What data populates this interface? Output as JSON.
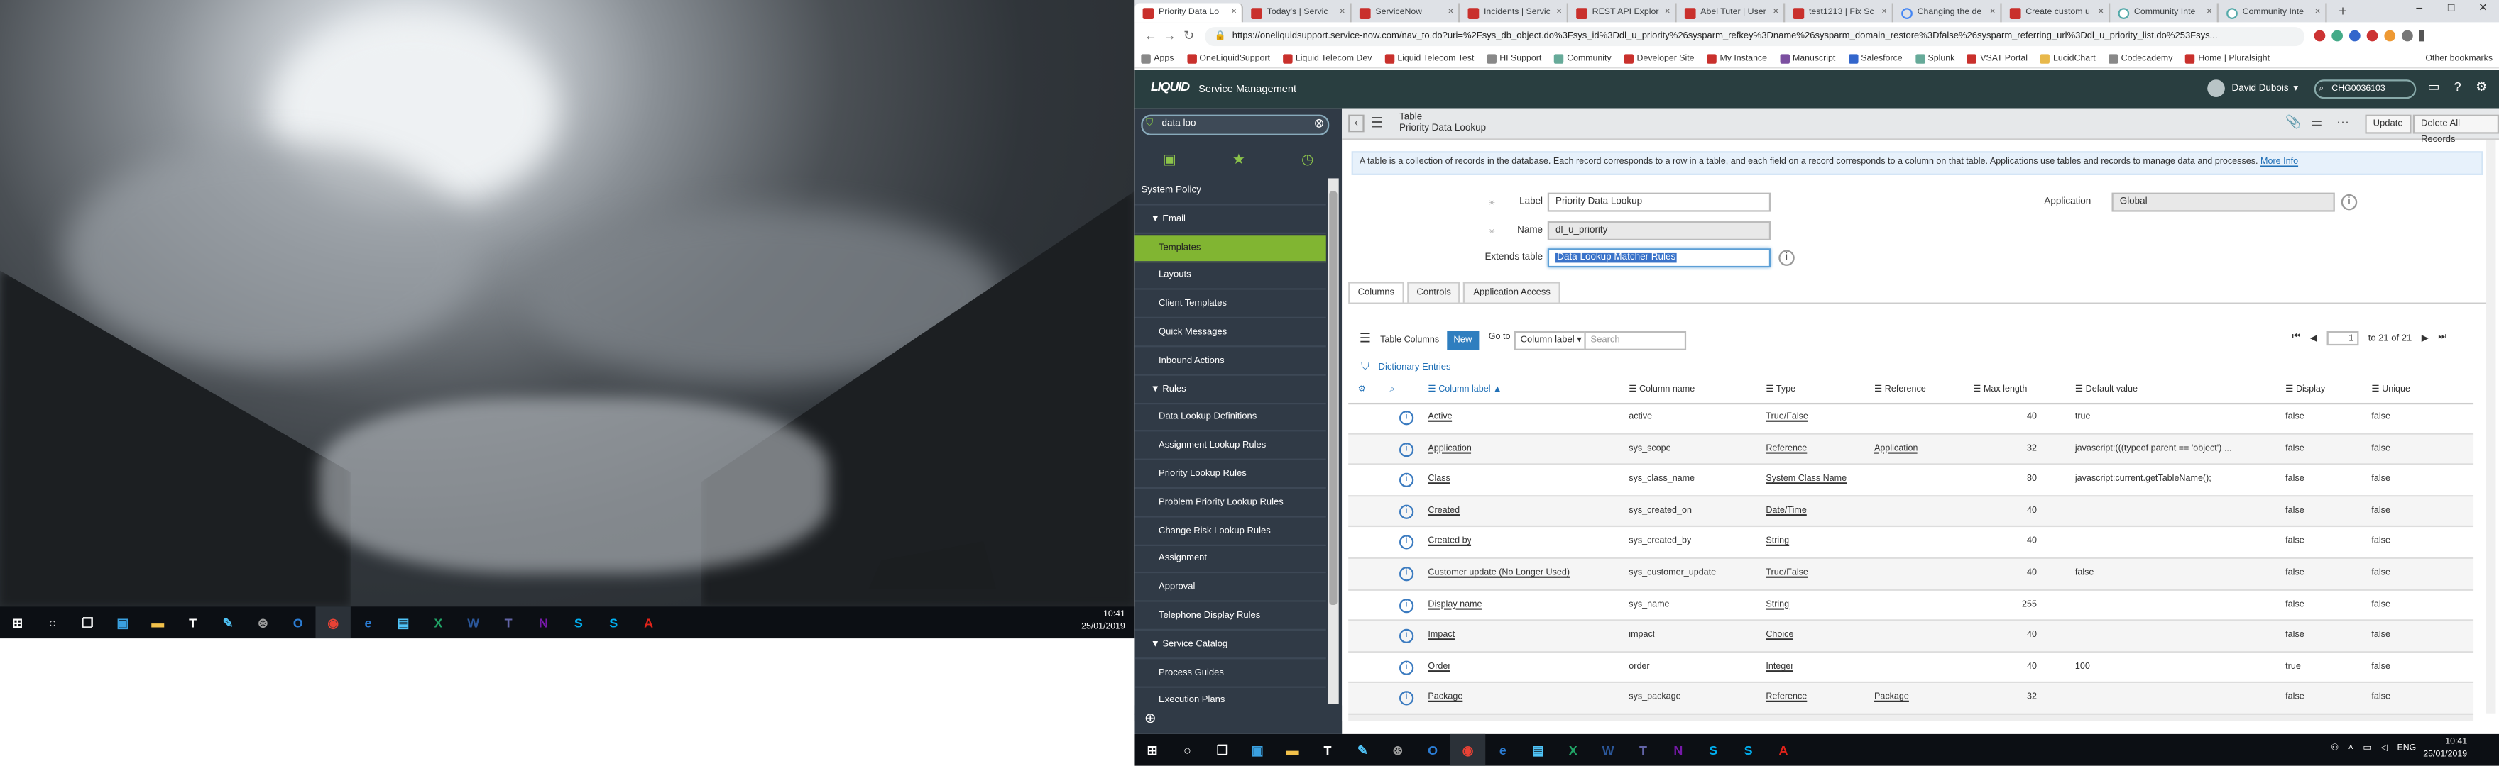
{
  "left_monitor": {
    "taskbar": {
      "icons": [
        "windows-start-icon",
        "cortana-icon",
        "task-view-icon",
        "app-icon",
        "folder-icon",
        "tool-icon",
        "edit-icon",
        "network-icon",
        "outlook-icon",
        "chrome-icon",
        "edge-icon",
        "app2-icon",
        "excel-icon",
        "word-icon",
        "teams-icon",
        "onenote-icon",
        "skype-icon",
        "skype2-icon",
        "acrobat-icon"
      ],
      "time": "10:41",
      "date": "25/01/2019"
    }
  },
  "browser": {
    "tabs": [
      {
        "label": "Priority Data Lo",
        "active": true
      },
      {
        "label": "Today's | Servic",
        "active": false
      },
      {
        "label": "ServiceNow",
        "active": false
      },
      {
        "label": "Incidents | Servic",
        "active": false
      },
      {
        "label": "REST API Explor",
        "active": false
      },
      {
        "label": "Abel Tuter | User",
        "active": false
      },
      {
        "label": "test1213 | Fix Sc",
        "active": false
      },
      {
        "label": "Changing the de",
        "active": false
      },
      {
        "label": "Create custom u",
        "active": false
      },
      {
        "label": "Community Inte",
        "active": false
      },
      {
        "label": "Community Inte",
        "active": false
      }
    ],
    "new_tab": "+",
    "window_controls": [
      "–",
      "□",
      "✕"
    ],
    "url": "https://oneliquidsupport.service-now.com/nav_to.do?uri=%2Fsys_db_object.do%3Fsys_id%3Ddl_u_priority%26sysparm_refkey%3Dname%26sysparm_domain_restore%3Dfalse%26sysparm_referring_url%3Ddl_u_priority_list.do%253Fsys...",
    "bookmarks": [
      {
        "label": "Apps",
        "icon": "apps-icon"
      },
      {
        "label": "OneLiquidSupport",
        "icon": "sn-icon"
      },
      {
        "label": "Liquid Telecom Dev",
        "icon": "sn-icon"
      },
      {
        "label": "Liquid Telecom Test",
        "icon": "sn-icon"
      },
      {
        "label": "HI Support",
        "icon": "hi-icon"
      },
      {
        "label": "Community",
        "icon": "community-icon"
      },
      {
        "label": "Developer Site",
        "icon": "sn-icon"
      },
      {
        "label": "My Instance",
        "icon": "sn-icon"
      },
      {
        "label": "Manuscript",
        "icon": "manuscript-icon"
      },
      {
        "label": "Salesforce",
        "icon": "salesforce-icon"
      },
      {
        "label": "Splunk",
        "icon": "splunk-icon"
      },
      {
        "label": "VSAT Portal",
        "icon": "sn-icon"
      },
      {
        "label": "LucidChart",
        "icon": "lucid-icon"
      },
      {
        "label": "Codecademy",
        "icon": "codecademy-icon"
      },
      {
        "label": "Home | Pluralsight",
        "icon": "pluralsight-icon"
      }
    ],
    "other_bookmarks": "Other bookmarks"
  },
  "servicenow": {
    "logo": "LIQUID",
    "app_name": "Service Management",
    "user_name": "David Dubois",
    "global_search": "CHG0036103",
    "nav": {
      "filter": "data loo",
      "items": [
        {
          "label": "System Policy",
          "kind": "sec"
        },
        {
          "label": "▼ Email",
          "kind": "mod"
        },
        {
          "label": "Templates",
          "kind": "lnk",
          "active": true
        },
        {
          "label": "Layouts",
          "kind": "lnk"
        },
        {
          "label": "Client Templates",
          "kind": "lnk"
        },
        {
          "label": "Quick Messages",
          "kind": "lnk"
        },
        {
          "label": "Inbound Actions",
          "kind": "lnk"
        },
        {
          "label": "▼ Rules",
          "kind": "mod"
        },
        {
          "label": "Data Lookup Definitions",
          "kind": "lnk"
        },
        {
          "label": "Assignment Lookup Rules",
          "kind": "lnk"
        },
        {
          "label": "Priority Lookup Rules",
          "kind": "lnk"
        },
        {
          "label": "Problem Priority Lookup Rules",
          "kind": "lnk"
        },
        {
          "label": "Change Risk Lookup Rules",
          "kind": "lnk"
        },
        {
          "label": "Assignment",
          "kind": "lnk"
        },
        {
          "label": "Approval",
          "kind": "lnk"
        },
        {
          "label": "Telephone Display Rules",
          "kind": "lnk"
        },
        {
          "label": "▼ Service Catalog",
          "kind": "mod"
        },
        {
          "label": "Process Guides",
          "kind": "lnk"
        },
        {
          "label": "Execution Plans",
          "kind": "lnk"
        }
      ]
    },
    "form": {
      "type": "Table",
      "title": "Priority Data Lookup",
      "update_btn": "Update",
      "delete_btn": "Delete All Records",
      "info_text": "A table is a collection of records in the database. Each record corresponds to a row in a table, and each field on a record corresponds to a column on that table. Applications use tables and records to manage data and processes.",
      "info_link": "More Info",
      "label_label": "Label",
      "label_value": "Priority Data Lookup",
      "name_label": "Name",
      "name_value": "dl_u_priority",
      "extends_label": "Extends table",
      "extends_value": "Data Lookup Matcher Rules",
      "application_label": "Application",
      "application_value": "Global",
      "tabs": [
        "Columns",
        "Controls",
        "Application Access"
      ]
    },
    "list": {
      "title": "Table Columns",
      "new_btn": "New",
      "goto_label": "Go to",
      "goto_select": "Column label",
      "search_placeholder": "Search",
      "page_value": "1",
      "page_text": "to 21 of 21",
      "related_link": "Dictionary Entries",
      "headers": {
        "label": "Column label",
        "name": "Column name",
        "type": "Type",
        "reference": "Reference",
        "max_length": "Max length",
        "default_value": "Default value",
        "display": "Display",
        "unique": "Unique"
      },
      "rows": [
        {
          "label": "Active",
          "name": "active",
          "type": "True/False",
          "reference": "",
          "max_length": "40",
          "default_value": "true",
          "display": "false",
          "unique": "false"
        },
        {
          "label": "Application",
          "name": "sys_scope",
          "type": "Reference",
          "reference": "Application",
          "max_length": "32",
          "default_value": "javascript:(((typeof parent == 'object') ...",
          "display": "false",
          "unique": "false"
        },
        {
          "label": "Class",
          "name": "sys_class_name",
          "type": "System Class Name",
          "reference": "",
          "max_length": "80",
          "default_value": "javascript:current.getTableName();",
          "display": "false",
          "unique": "false"
        },
        {
          "label": "Created",
          "name": "sys_created_on",
          "type": "Date/Time",
          "reference": "",
          "max_length": "40",
          "default_value": "",
          "display": "false",
          "unique": "false"
        },
        {
          "label": "Created by",
          "name": "sys_created_by",
          "type": "String",
          "reference": "",
          "max_length": "40",
          "default_value": "",
          "display": "false",
          "unique": "false"
        },
        {
          "label": "Customer update (No Longer Used)",
          "name": "sys_customer_update",
          "type": "True/False",
          "reference": "",
          "max_length": "40",
          "default_value": "false",
          "display": "false",
          "unique": "false"
        },
        {
          "label": "Display name",
          "name": "sys_name",
          "type": "String",
          "reference": "",
          "max_length": "255",
          "default_value": "",
          "display": "false",
          "unique": "false"
        },
        {
          "label": "Impact",
          "name": "impact",
          "type": "Choice",
          "reference": "",
          "max_length": "40",
          "default_value": "",
          "display": "false",
          "unique": "false"
        },
        {
          "label": "Order",
          "name": "order",
          "type": "Integer",
          "reference": "",
          "max_length": "40",
          "default_value": "100",
          "display": "true",
          "unique": "false"
        },
        {
          "label": "Package",
          "name": "sys_package",
          "type": "Reference",
          "reference": "Package",
          "max_length": "32",
          "default_value": "",
          "display": "false",
          "unique": "false"
        }
      ]
    }
  },
  "right_monitor": {
    "taskbar": {
      "time": "10:41",
      "date": "25/01/2019",
      "lang": "ENG"
    }
  }
}
